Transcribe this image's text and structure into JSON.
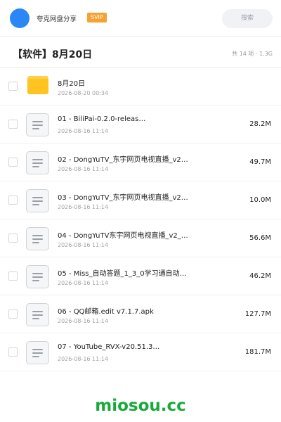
{
  "header": {
    "brand": "夸克网盘分享",
    "badge": "SVIP",
    "search_placeholder": "搜索"
  },
  "folder": {
    "title": "【软件】8月20日",
    "meta": "共 14 项 · 1.3G"
  },
  "items": [
    {
      "type": "folder",
      "name": "8月20日",
      "date": "2026-08-20 00:34",
      "size": ""
    },
    {
      "type": "file",
      "name": "01 - BiliPai-0.2.0-releas…",
      "date": "2026-08-16 11:14",
      "size": "28.2M"
    },
    {
      "type": "file",
      "name": "02 - DongYuTV_东宇网页电视直播_v2…",
      "date": "2026-08-16 11:14",
      "size": "49.7M"
    },
    {
      "type": "file",
      "name": "03 - DongYuTV_东宇网页电视直播_v2…",
      "date": "2026-08-16 11:14",
      "size": "10.0M"
    },
    {
      "type": "file",
      "name": "04 - DongYuTV东宇网页电视直播_v2_…",
      "date": "2026-08-16 11:14",
      "size": "56.6M"
    },
    {
      "type": "file",
      "name": "05 - Miss_自动答题_1_3_0学习通自动…",
      "date": "2026-08-16 11:14",
      "size": "46.2M"
    },
    {
      "type": "file",
      "name": "06 - QQ邮箱.edit v7.1.7.apk",
      "date": "2026-08-16 11:14",
      "size": "127.7M"
    },
    {
      "type": "file",
      "name": "07 - YouTube_RVX-v20.51.3…",
      "date": "2026-08-16 11:14",
      "size": "181.7M"
    }
  ],
  "watermark": "miosou.cc",
  "colors": {
    "avatar": "#2b86f6",
    "badge": "#f6a233",
    "folder": "#ffc41f",
    "watermark": "#19a93b"
  }
}
